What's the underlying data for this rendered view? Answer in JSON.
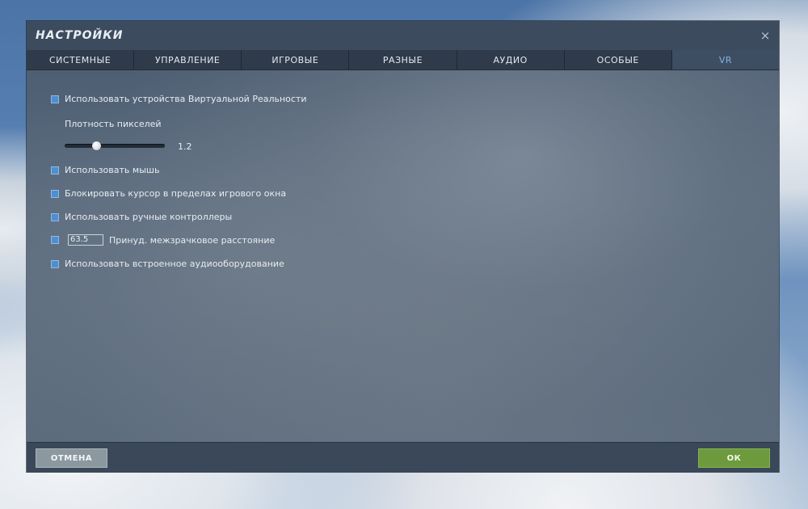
{
  "dialog": {
    "title": "НАСТРОЙКИ",
    "close_symbol": "×"
  },
  "tabs": [
    {
      "label": "СИСТЕМНЫЕ",
      "active": false
    },
    {
      "label": "УПРАВЛЕНИЕ",
      "active": false
    },
    {
      "label": "ИГРОВЫЕ",
      "active": false
    },
    {
      "label": "РАЗНЫЕ",
      "active": false
    },
    {
      "label": "АУДИО",
      "active": false
    },
    {
      "label": "ОСОБЫЕ",
      "active": false
    },
    {
      "label": "VR",
      "active": true
    }
  ],
  "vr": {
    "use_vr": {
      "label": "Использовать устройства Виртуальной Реальности",
      "checked": true
    },
    "pixel_density": {
      "label": "Плотность пикселей",
      "value": "1.2",
      "fraction": 0.3
    },
    "use_mouse": {
      "label": "Использовать мышь",
      "checked": true
    },
    "lock_cursor": {
      "label": "Блокировать курсор в пределах игрового окна",
      "checked": true
    },
    "hand_controllers": {
      "label": "Использовать ручные контроллеры",
      "checked": true
    },
    "ipd": {
      "label": "Принуд. межзрачковое расстояние",
      "value": "63.5",
      "checked": true
    },
    "builtin_audio": {
      "label": "Использовать встроенное аудиооборудование",
      "checked": true
    }
  },
  "footer": {
    "cancel_label": "ОТМЕНА",
    "ok_label": "ОК"
  },
  "colors": {
    "accent_tab": "#7fb3e6",
    "checkbox": "#4f8fd0",
    "ok_button": "#6d9a3c",
    "cancel_button": "#8c989f"
  }
}
